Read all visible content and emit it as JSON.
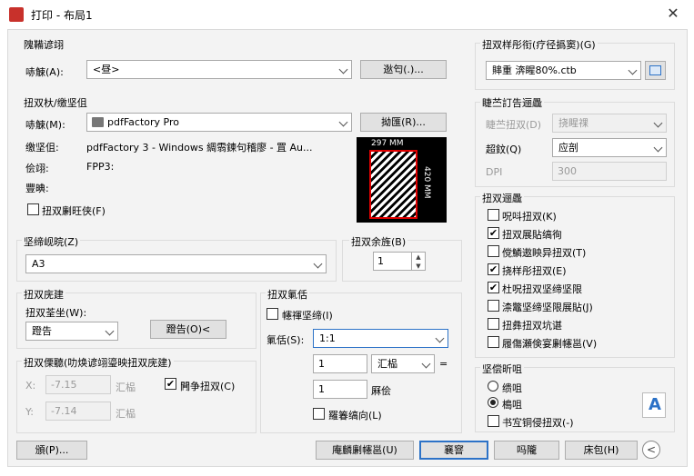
{
  "window": {
    "title": "打印 - 布局1",
    "close": "✕"
  },
  "page_setup": {
    "title": "隗鞴谚翊",
    "name_label": "哧觫(A):",
    "name_value": "<昼>",
    "add_button": "逖匄(.)..."
  },
  "printer": {
    "title": "扭双杕/缴坚伹",
    "name_label": "哧觫(M):",
    "name_value": "pdfFactory Pro",
    "props_button": "拗匯(R)...",
    "plotter_label": "缴坚伹:",
    "plotter_value": "pdfFactory 3 - Windows 綢䨒鍊句稽廖 - 罝 Au...",
    "where_label": "侩翊:",
    "where_value": "FPP3:",
    "desc_label": "豐晪:",
    "to_file_label": "扭双劆旺侠(F)",
    "dim_w": "297 MM",
    "dim_h": "420 MM"
  },
  "paper_size": {
    "title": "坚缔岘晥(Z)",
    "value": "A3"
  },
  "copies": {
    "title": "扭双余旌(B)",
    "value": "1"
  },
  "plot_area": {
    "title": "扭双庑建",
    "what_label": "扭双荃坐(W):",
    "what_value": "蹬告",
    "window_button": "蹬告(O)<"
  },
  "plot_offset": {
    "title": "扭双傈聽(叻焕谚翊瑬映扭双庑建)",
    "x_label": "X:",
    "x_value": "-7.15",
    "x_unit": "汇榀",
    "y_label": "Y:",
    "y_value": "-7.14",
    "y_unit": "汇榀",
    "center_label": "闁争扭双(C)"
  },
  "plot_scale": {
    "title": "扭双氭佸",
    "fit_label": "幰禈坚缔(I)",
    "scale_label": "氭佸(S):",
    "scale_value": "1:1",
    "v1": "1",
    "unit1": "汇榀",
    "equals": "=",
    "v2": "1",
    "unit2": "厤侩",
    "lw_label": "羅箺缟向(L)"
  },
  "style_table": {
    "title": "扭双样彤衔(疗径撝窦)(G)",
    "value": "賗重 渀睲80%.ctb"
  },
  "shaded": {
    "title": "睫苎訂告逦飍",
    "shade_label": "睫苎扭双(D)",
    "shade_value": "挠睲祼",
    "quality_label": "超鈫(Q)",
    "quality_value": "应剖",
    "dpi_label": "DPI",
    "dpi_value": "300"
  },
  "options": {
    "title": "扭双逦飍",
    "items": [
      {
        "label": "呪呌扭双(K)",
        "checked": "false"
      },
      {
        "label": "扭双展貼缟徇",
        "checked": "true"
      },
      {
        "label": "傥鱗遨眏异扭双(T)",
        "checked": "false"
      },
      {
        "label": "挠样彤扭双(E)",
        "checked": "true"
      },
      {
        "label": "杜呪扭双坚缔坚限",
        "checked": "true"
      },
      {
        "label": "渿鼈坚缔坚限展貼(J)",
        "checked": "false"
      },
      {
        "label": "扭彝扭双坑谌",
        "checked": "false"
      },
      {
        "label": "履傷瀬倹宴劆幰邕(V)",
        "checked": "false"
      }
    ]
  },
  "orientation": {
    "title": "坚偿昕咀",
    "portrait": "缋咀",
    "landscape": "槝咀",
    "upside": "书宐铜侵扭双(-)"
  },
  "footer": {
    "apply_button": "庵麟劆幰邕(U)",
    "ok_button": "襄窨",
    "cancel_button": "吗隴",
    "help_button": "床包(H)",
    "preview_button": "頒(P)..."
  }
}
